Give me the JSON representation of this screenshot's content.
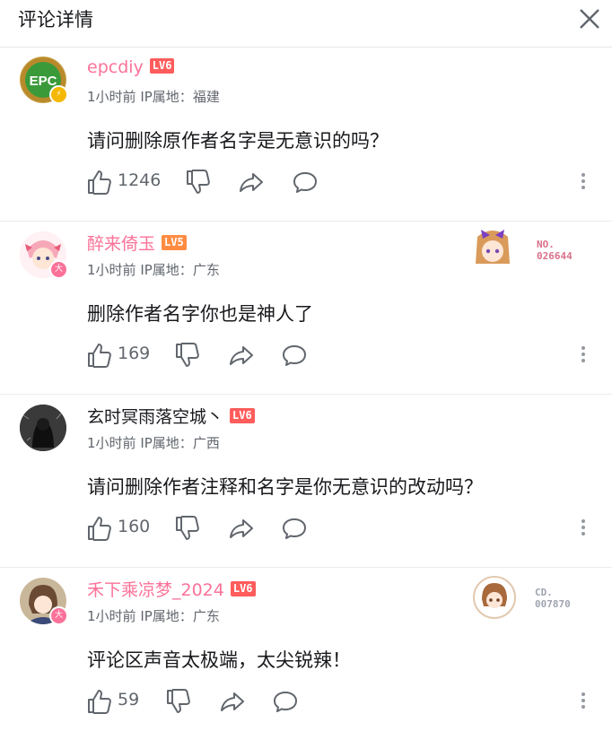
{
  "header": {
    "title": "评论详情"
  },
  "colors": {
    "pink_name": "#fb7299",
    "plain_name": "#18191c",
    "lv6": "#ff5c5c",
    "lv5": "#ff8c42",
    "meta": "#61666d"
  },
  "comments": [
    {
      "username": "epcdiy",
      "level": "LV6",
      "name_color": "#fb7299",
      "avatar_text": "EPC",
      "time": "1小时前",
      "ip_label": "IP属地：",
      "ip": "福建",
      "content": "请问删除原作者名字是无意识的吗？",
      "likes": "1246"
    },
    {
      "username": "醉来倚玉",
      "level": "LV5",
      "name_color": "#fb7299",
      "time": "1小时前",
      "ip_label": "IP属地：",
      "ip": "广东",
      "content": "删除作者名字你也是神人了",
      "likes": "169",
      "fan_no": [
        "NO.",
        "026644"
      ]
    },
    {
      "username": "玄时冥雨落空城丶",
      "level": "LV6",
      "name_color": "#18191c",
      "time": "1小时前",
      "ip_label": "IP属地：",
      "ip": "广西",
      "content": "请问删除作者注释和名字是你无意识的改动吗？",
      "likes": "160"
    },
    {
      "username": "禾下乘凉梦_2024",
      "level": "LV6",
      "name_color": "#fb7299",
      "time": "1小时前",
      "ip_label": "IP属地：",
      "ip": "广东",
      "content": "评论区声音太极端，太尖锐辣！",
      "likes": "59",
      "fan_no": [
        "CD.",
        "007870"
      ]
    }
  ]
}
